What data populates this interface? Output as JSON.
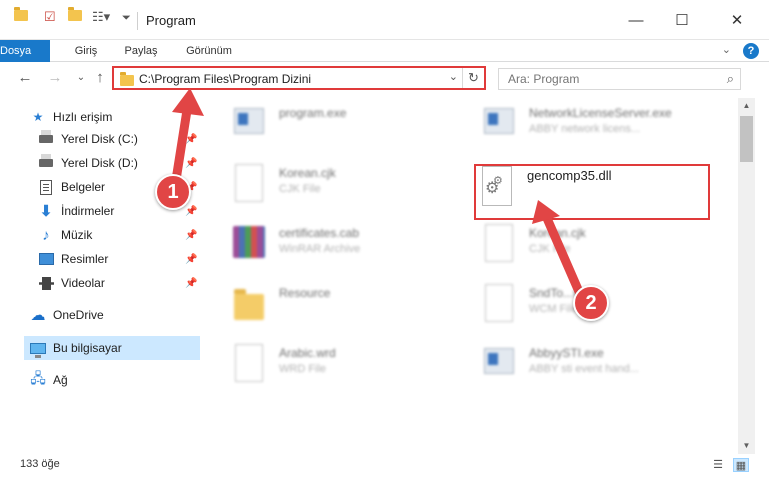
{
  "window": {
    "title": "Program",
    "controls": {
      "minimize": "—",
      "maximize": "☐",
      "close": "✕"
    }
  },
  "ribbon": {
    "tabs": [
      "Dosya",
      "Giriş",
      "Paylaş",
      "Görünüm"
    ],
    "help": "?"
  },
  "address": {
    "path": "C:\\Program Files\\Program Dizini",
    "refresh": "↻",
    "search_placeholder": "Ara: Program"
  },
  "sidebar": {
    "items": [
      {
        "label": "Hızlı erişim",
        "icon": "star-icon"
      },
      {
        "label": "Yerel Disk (C:)",
        "icon": "drive-icon"
      },
      {
        "label": "Yerel Disk (D:)",
        "icon": "drive-icon"
      },
      {
        "label": "Belgeler",
        "icon": "document-icon"
      },
      {
        "label": "İndirmeler",
        "icon": "download-icon"
      },
      {
        "label": "Müzik",
        "icon": "music-icon"
      },
      {
        "label": "Resimler",
        "icon": "pictures-icon"
      },
      {
        "label": "Videolar",
        "icon": "video-icon"
      },
      {
        "label": "OneDrive",
        "icon": "cloud-icon"
      },
      {
        "label": "Bu bilgisayar",
        "icon": "computer-icon"
      },
      {
        "label": "Ağ",
        "icon": "network-icon"
      }
    ]
  },
  "files": [
    {
      "name": "program.exe",
      "type": "",
      "icon": "exe-icon"
    },
    {
      "name": "NetworkLicenseServer.exe",
      "type": "ABBY network licens...",
      "icon": "exe-icon"
    },
    {
      "name": "Korean.cjk",
      "type": "CJK File",
      "icon": "file-icon"
    },
    {
      "name": "gencomp35.dll",
      "type": "",
      "icon": "dll-gear-icon"
    },
    {
      "name": "certificates.cab",
      "type": "WinRAR Archive",
      "icon": "winrar-icon"
    },
    {
      "name": "Korean.cjk",
      "type": "CJK File",
      "icon": "file-icon"
    },
    {
      "name": "Resource",
      "type": "",
      "icon": "folder-icon"
    },
    {
      "name": "SndTo...wcm",
      "type": "WCM File",
      "icon": "file-icon"
    },
    {
      "name": "Arabic.wrd",
      "type": "WRD File",
      "icon": "file-icon"
    },
    {
      "name": "AbbyySTI.exe",
      "type": "ABBY sti event hand...",
      "icon": "exe-icon"
    }
  ],
  "status": {
    "count": "133 öğe"
  },
  "callouts": [
    "1",
    "2"
  ],
  "colors": {
    "accent": "#1979ca",
    "highlight": "#e03a3a",
    "selection": "#cce8ff"
  }
}
